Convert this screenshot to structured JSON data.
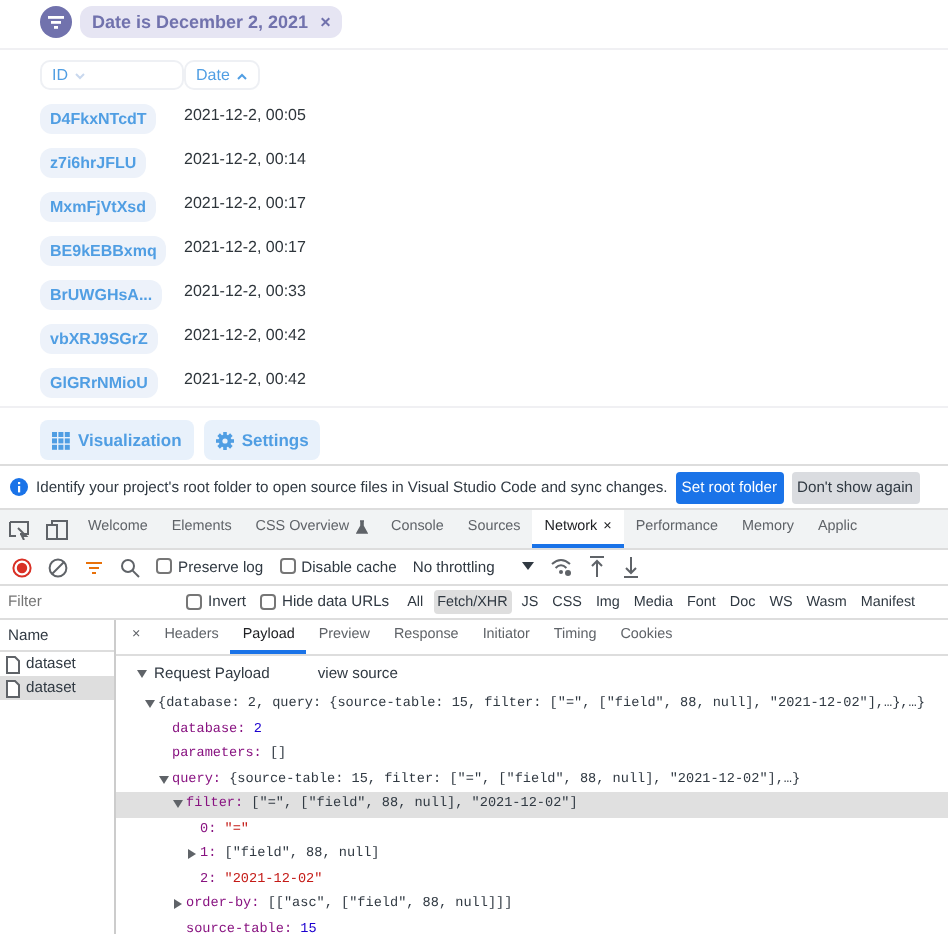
{
  "filter_bar": {
    "chip": "Date is December 2, 2021",
    "remove": "×"
  },
  "table": {
    "columns": [
      {
        "label": "ID",
        "sorted": false
      },
      {
        "label": "Date",
        "sorted": true
      }
    ],
    "rows": [
      {
        "id": "D4FkxNTcdT",
        "date": "2021-12-2, 00:05"
      },
      {
        "id": "z7i6hrJFLU",
        "date": "2021-12-2, 00:14"
      },
      {
        "id": "MxmFjVtXsd",
        "date": "2021-12-2, 00:17"
      },
      {
        "id": "BE9kEBBxmq",
        "date": "2021-12-2, 00:17"
      },
      {
        "id": "BrUWGHsA...",
        "date": "2021-12-2, 00:33"
      },
      {
        "id": "vbXRJ9SGrZ",
        "date": "2021-12-2, 00:42"
      },
      {
        "id": "GlGRrNMioU",
        "date": "2021-12-2, 00:42"
      }
    ]
  },
  "footer_buttons": [
    {
      "label": "Visualization",
      "kind": "grid"
    },
    {
      "label": "Settings",
      "kind": "gear"
    }
  ],
  "devtools": {
    "infobar": {
      "text": "Identify your project's root folder to open source files in Visual Studio Code and sync changes.",
      "buttons": [
        {
          "label": "Set root folder",
          "primary": true
        },
        {
          "label": "Don't show again",
          "primary": false
        }
      ]
    },
    "tabs": [
      {
        "label": "Welcome",
        "selected": false,
        "experimental": false
      },
      {
        "label": "Elements",
        "selected": false,
        "experimental": false
      },
      {
        "label": "CSS Overview",
        "selected": false,
        "experimental": true
      },
      {
        "label": "Console",
        "selected": false,
        "experimental": false
      },
      {
        "label": "Sources",
        "selected": false,
        "experimental": false
      },
      {
        "label": "Network",
        "selected": true,
        "experimental": false,
        "close": "×"
      },
      {
        "label": "Performance",
        "selected": false,
        "experimental": false
      },
      {
        "label": "Memory",
        "selected": false,
        "experimental": false
      },
      {
        "label": "Applic",
        "selected": false,
        "experimental": false
      }
    ],
    "toolbar": {
      "recording": true,
      "preserve_log": {
        "label": "Preserve log",
        "checked": false
      },
      "disable_cache": {
        "label": "Disable cache",
        "checked": false
      },
      "throttling": "No throttling"
    },
    "filter": {
      "placeholder": "Filter",
      "invert": {
        "label": "Invert",
        "checked": false
      },
      "hide_data_urls": {
        "label": "Hide data URLs",
        "checked": false
      },
      "types": [
        {
          "label": "All",
          "selected": false
        },
        {
          "label": "Fetch/XHR",
          "selected": true
        },
        {
          "label": "JS",
          "selected": false
        },
        {
          "label": "CSS",
          "selected": false
        },
        {
          "label": "Img",
          "selected": false
        },
        {
          "label": "Media",
          "selected": false
        },
        {
          "label": "Font",
          "selected": false
        },
        {
          "label": "Doc",
          "selected": false
        },
        {
          "label": "WS",
          "selected": false
        },
        {
          "label": "Wasm",
          "selected": false
        },
        {
          "label": "Manifest",
          "selected": false
        }
      ]
    },
    "requests": {
      "header": "Name",
      "items": [
        {
          "name": "dataset",
          "selected": false
        },
        {
          "name": "dataset",
          "selected": true
        }
      ]
    },
    "detail": {
      "close": "×",
      "tabs": [
        {
          "label": "Headers",
          "selected": false
        },
        {
          "label": "Payload",
          "selected": true
        },
        {
          "label": "Preview",
          "selected": false
        },
        {
          "label": "Response",
          "selected": false
        },
        {
          "label": "Initiator",
          "selected": false
        },
        {
          "label": "Timing",
          "selected": false
        },
        {
          "label": "Cookies",
          "selected": false
        }
      ]
    },
    "payload": {
      "section": "Request Payload",
      "expanded": true,
      "view_source": "view source",
      "tree": [
        {
          "value": "{database: 2, query: {source-table: 15, filter: [\"=\", [\"field\", 88, null], \"2021-12-02\"],…},…}",
          "kind": "plain",
          "expanded": true,
          "selected": false,
          "children": [
            {
              "key": "database:",
              "value": "2",
              "kind": "number",
              "selected": false
            },
            {
              "key": "parameters:",
              "value": "[]",
              "kind": "plain",
              "selected": false
            },
            {
              "key": "query:",
              "value": "{source-table: 15, filter: [\"=\", [\"field\", 88, null], \"2021-12-02\"],…}",
              "kind": "plain",
              "expanded": true,
              "selected": false,
              "children": [
                {
                  "key": "filter:",
                  "value": "[\"=\", [\"field\", 88, null], \"2021-12-02\"]",
                  "kind": "plain",
                  "expanded": true,
                  "selected": true,
                  "children": [
                    {
                      "key": "0:",
                      "value": "\"=\"",
                      "kind": "string",
                      "selected": false
                    },
                    {
                      "key": "1:",
                      "value": "[\"field\", 88, null]",
                      "kind": "plain",
                      "expanded": false,
                      "selected": false
                    },
                    {
                      "key": "2:",
                      "value": "\"2021-12-02\"",
                      "kind": "string",
                      "selected": false
                    }
                  ]
                },
                {
                  "key": "order-by:",
                  "value": "[[\"asc\", [\"field\", 88, null]]]",
                  "kind": "plain",
                  "expanded": false,
                  "selected": false
                },
                {
                  "key": "source-table:",
                  "value": "15",
                  "kind": "number",
                  "selected": false
                }
              ]
            }
          ]
        }
      ]
    }
  }
}
